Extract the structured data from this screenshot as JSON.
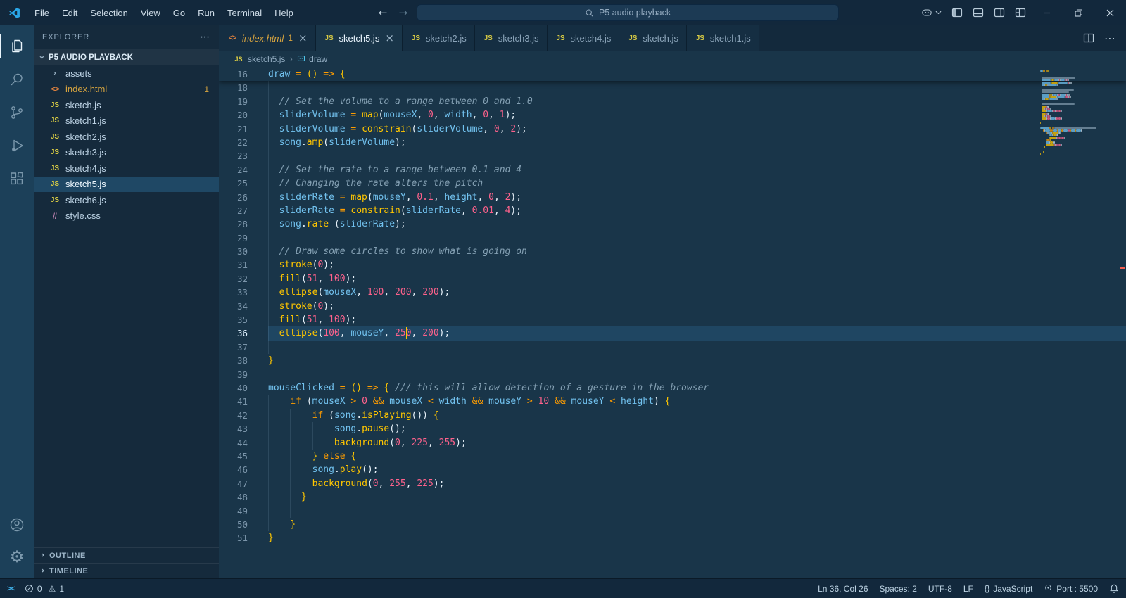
{
  "titlebar": {
    "menus": [
      "File",
      "Edit",
      "Selection",
      "View",
      "Go",
      "Run",
      "Terminal",
      "Help"
    ],
    "search": "P5 audio playback"
  },
  "activitybar": {
    "items": [
      {
        "name": "explorer",
        "active": true
      },
      {
        "name": "search"
      },
      {
        "name": "source-control"
      },
      {
        "name": "run-debug"
      },
      {
        "name": "extensions"
      }
    ],
    "bottom": [
      {
        "name": "account"
      },
      {
        "name": "settings"
      }
    ]
  },
  "sidebar": {
    "title": "EXPLORER",
    "project": "P5 AUDIO PLAYBACK",
    "files": [
      {
        "label": "assets",
        "icon": "folder"
      },
      {
        "label": "index.html",
        "icon": "html",
        "badge": "1",
        "warning": true
      },
      {
        "label": "sketch.js",
        "icon": "js"
      },
      {
        "label": "sketch1.js",
        "icon": "js"
      },
      {
        "label": "sketch2.js",
        "icon": "js"
      },
      {
        "label": "sketch3.js",
        "icon": "js"
      },
      {
        "label": "sketch4.js",
        "icon": "js"
      },
      {
        "label": "sketch5.js",
        "icon": "js",
        "selected": true
      },
      {
        "label": "sketch6.js",
        "icon": "js"
      },
      {
        "label": "style.css",
        "icon": "css"
      }
    ],
    "sections": [
      "OUTLINE",
      "TIMELINE"
    ]
  },
  "tabs": [
    {
      "label": "index.html",
      "icon": "html",
      "badge": "1",
      "warning": true,
      "closable": true
    },
    {
      "label": "sketch5.js",
      "icon": "js",
      "active": true,
      "closable": true
    },
    {
      "label": "sketch2.js",
      "icon": "js"
    },
    {
      "label": "sketch3.js",
      "icon": "js"
    },
    {
      "label": "sketch4.js",
      "icon": "js"
    },
    {
      "label": "sketch.js",
      "icon": "js"
    },
    {
      "label": "sketch1.js",
      "icon": "js"
    }
  ],
  "breadcrumb": [
    {
      "label": "sketch5.js",
      "icon": "js"
    },
    {
      "label": "draw",
      "icon": "symbol"
    }
  ],
  "editor": {
    "current_line": 36,
    "cursor_col": 26,
    "sticky": {
      "n": 16,
      "g": 0,
      "t": [
        [
          "v",
          "draw "
        ],
        [
          "k",
          "= "
        ],
        [
          "f",
          "()"
        ],
        [
          "p",
          " "
        ],
        [
          "k",
          "=> "
        ],
        [
          "f",
          "{"
        ]
      ]
    },
    "lines": [
      {
        "n": 18,
        "g": 2,
        "t": []
      },
      {
        "n": 19,
        "g": 2,
        "t": [
          [
            "c",
            "  // Set the volume to a range between 0 and 1.0"
          ]
        ]
      },
      {
        "n": 20,
        "g": 2,
        "t": [
          [
            "p",
            "  "
          ],
          [
            "v",
            "sliderVolume "
          ],
          [
            "k",
            "= "
          ],
          [
            "f",
            "map"
          ],
          [
            "p",
            "("
          ],
          [
            "v",
            "mouseX"
          ],
          [
            "p",
            ", "
          ],
          [
            "n",
            "0"
          ],
          [
            "p",
            ", "
          ],
          [
            "v",
            "width"
          ],
          [
            "p",
            ", "
          ],
          [
            "n",
            "0"
          ],
          [
            "p",
            ", "
          ],
          [
            "n",
            "1"
          ],
          [
            "p",
            ");"
          ]
        ]
      },
      {
        "n": 21,
        "g": 2,
        "t": [
          [
            "p",
            "  "
          ],
          [
            "v",
            "sliderVolume "
          ],
          [
            "k",
            "= "
          ],
          [
            "f",
            "constrain"
          ],
          [
            "p",
            "("
          ],
          [
            "v",
            "sliderVolume"
          ],
          [
            "p",
            ", "
          ],
          [
            "n",
            "0"
          ],
          [
            "p",
            ", "
          ],
          [
            "n",
            "2"
          ],
          [
            "p",
            ");"
          ]
        ]
      },
      {
        "n": 22,
        "g": 2,
        "t": [
          [
            "p",
            "  "
          ],
          [
            "v",
            "song"
          ],
          [
            "p",
            "."
          ],
          [
            "f",
            "amp"
          ],
          [
            "p",
            "("
          ],
          [
            "v",
            "sliderVolume"
          ],
          [
            "p",
            ");"
          ]
        ]
      },
      {
        "n": 23,
        "g": 2,
        "t": []
      },
      {
        "n": 24,
        "g": 2,
        "t": [
          [
            "c",
            "  // Set the rate to a range between 0.1 and 4"
          ]
        ]
      },
      {
        "n": 25,
        "g": 2,
        "t": [
          [
            "c",
            "  // Changing the rate alters the pitch"
          ]
        ]
      },
      {
        "n": 26,
        "g": 2,
        "t": [
          [
            "p",
            "  "
          ],
          [
            "v",
            "sliderRate "
          ],
          [
            "k",
            "= "
          ],
          [
            "f",
            "map"
          ],
          [
            "p",
            "("
          ],
          [
            "v",
            "mouseY"
          ],
          [
            "p",
            ", "
          ],
          [
            "n",
            "0.1"
          ],
          [
            "p",
            ", "
          ],
          [
            "v",
            "height"
          ],
          [
            "p",
            ", "
          ],
          [
            "n",
            "0"
          ],
          [
            "p",
            ", "
          ],
          [
            "n",
            "2"
          ],
          [
            "p",
            ");"
          ]
        ]
      },
      {
        "n": 27,
        "g": 2,
        "t": [
          [
            "p",
            "  "
          ],
          [
            "v",
            "sliderRate "
          ],
          [
            "k",
            "= "
          ],
          [
            "f",
            "constrain"
          ],
          [
            "p",
            "("
          ],
          [
            "v",
            "sliderRate"
          ],
          [
            "p",
            ", "
          ],
          [
            "n",
            "0.01"
          ],
          [
            "p",
            ", "
          ],
          [
            "n",
            "4"
          ],
          [
            "p",
            ");"
          ]
        ]
      },
      {
        "n": 28,
        "g": 2,
        "t": [
          [
            "p",
            "  "
          ],
          [
            "v",
            "song"
          ],
          [
            "p",
            "."
          ],
          [
            "f",
            "rate "
          ],
          [
            "p",
            "("
          ],
          [
            "v",
            "sliderRate"
          ],
          [
            "p",
            ");"
          ]
        ]
      },
      {
        "n": 29,
        "g": 2,
        "t": []
      },
      {
        "n": 30,
        "g": 2,
        "t": [
          [
            "c",
            "  // Draw some circles to show what is going on"
          ]
        ]
      },
      {
        "n": 31,
        "g": 2,
        "t": [
          [
            "p",
            "  "
          ],
          [
            "f",
            "stroke"
          ],
          [
            "p",
            "("
          ],
          [
            "n",
            "0"
          ],
          [
            "p",
            ");"
          ]
        ]
      },
      {
        "n": 32,
        "g": 2,
        "t": [
          [
            "p",
            "  "
          ],
          [
            "f",
            "fill"
          ],
          [
            "p",
            "("
          ],
          [
            "n",
            "51"
          ],
          [
            "p",
            ", "
          ],
          [
            "n",
            "100"
          ],
          [
            "p",
            ");"
          ]
        ]
      },
      {
        "n": 33,
        "g": 2,
        "t": [
          [
            "p",
            "  "
          ],
          [
            "f",
            "ellipse"
          ],
          [
            "p",
            "("
          ],
          [
            "v",
            "mouseX"
          ],
          [
            "p",
            ", "
          ],
          [
            "n",
            "100"
          ],
          [
            "p",
            ", "
          ],
          [
            "n",
            "200"
          ],
          [
            "p",
            ", "
          ],
          [
            "n",
            "200"
          ],
          [
            "p",
            ");"
          ]
        ]
      },
      {
        "n": 34,
        "g": 2,
        "t": [
          [
            "p",
            "  "
          ],
          [
            "f",
            "stroke"
          ],
          [
            "p",
            "("
          ],
          [
            "n",
            "0"
          ],
          [
            "p",
            ");"
          ]
        ]
      },
      {
        "n": 35,
        "g": 2,
        "t": [
          [
            "p",
            "  "
          ],
          [
            "f",
            "fill"
          ],
          [
            "p",
            "("
          ],
          [
            "n",
            "51"
          ],
          [
            "p",
            ", "
          ],
          [
            "n",
            "100"
          ],
          [
            "p",
            ");"
          ]
        ]
      },
      {
        "n": 36,
        "g": 2,
        "t": [
          [
            "p",
            "  "
          ],
          [
            "f",
            "ellipse"
          ],
          [
            "p",
            "("
          ],
          [
            "n",
            "100"
          ],
          [
            "p",
            ", "
          ],
          [
            "v",
            "mouseY"
          ],
          [
            "p",
            ", "
          ],
          [
            "n",
            "250"
          ],
          [
            "p",
            ", "
          ],
          [
            "n",
            "200"
          ],
          [
            "p",
            ");"
          ]
        ]
      },
      {
        "n": 37,
        "g": 2,
        "t": []
      },
      {
        "n": 38,
        "g": 0,
        "t": [
          [
            "f",
            "}"
          ]
        ]
      },
      {
        "n": 39,
        "g": 0,
        "t": []
      },
      {
        "n": 40,
        "g": 0,
        "t": [
          [
            "v",
            "mouseClicked "
          ],
          [
            "k",
            "= "
          ],
          [
            "f",
            "()"
          ],
          [
            "p",
            " "
          ],
          [
            "k",
            "=> "
          ],
          [
            "f",
            "{ "
          ],
          [
            "c",
            "/// this will allow detection of a gesture in the browser"
          ]
        ]
      },
      {
        "n": 41,
        "g": 4,
        "t": [
          [
            "p",
            "    "
          ],
          [
            "k",
            "if "
          ],
          [
            "p",
            "("
          ],
          [
            "v",
            "mouseX "
          ],
          [
            "k",
            "> "
          ],
          [
            "n",
            "0 "
          ],
          [
            "k",
            "&& "
          ],
          [
            "v",
            "mouseX "
          ],
          [
            "k",
            "< "
          ],
          [
            "v",
            "width "
          ],
          [
            "k",
            "&& "
          ],
          [
            "v",
            "mouseY "
          ],
          [
            "k",
            "> "
          ],
          [
            "n",
            "10 "
          ],
          [
            "k",
            "&& "
          ],
          [
            "v",
            "mouseY "
          ],
          [
            "k",
            "< "
          ],
          [
            "v",
            "height"
          ],
          [
            "p",
            ") "
          ],
          [
            "f",
            "{"
          ]
        ]
      },
      {
        "n": 42,
        "g": 8,
        "t": [
          [
            "p",
            "        "
          ],
          [
            "k",
            "if "
          ],
          [
            "p",
            "("
          ],
          [
            "v",
            "song"
          ],
          [
            "p",
            "."
          ],
          [
            "f",
            "isPlaying"
          ],
          [
            "p",
            "()) "
          ],
          [
            "f",
            "{"
          ]
        ]
      },
      {
        "n": 43,
        "g": 12,
        "t": [
          [
            "p",
            "            "
          ],
          [
            "v",
            "song"
          ],
          [
            "p",
            "."
          ],
          [
            "f",
            "pause"
          ],
          [
            "p",
            "();"
          ]
        ]
      },
      {
        "n": 44,
        "g": 12,
        "t": [
          [
            "p",
            "            "
          ],
          [
            "f",
            "background"
          ],
          [
            "p",
            "("
          ],
          [
            "n",
            "0"
          ],
          [
            "p",
            ", "
          ],
          [
            "n",
            "225"
          ],
          [
            "p",
            ", "
          ],
          [
            "n",
            "255"
          ],
          [
            "p",
            ");"
          ]
        ]
      },
      {
        "n": 45,
        "g": 8,
        "t": [
          [
            "p",
            "        "
          ],
          [
            "f",
            "} "
          ],
          [
            "k",
            "else "
          ],
          [
            "f",
            "{"
          ]
        ]
      },
      {
        "n": 46,
        "g": 8,
        "t": [
          [
            "p",
            "        "
          ],
          [
            "v",
            "song"
          ],
          [
            "p",
            "."
          ],
          [
            "f",
            "play"
          ],
          [
            "p",
            "();"
          ]
        ]
      },
      {
        "n": 47,
        "g": 8,
        "t": [
          [
            "p",
            "        "
          ],
          [
            "f",
            "background"
          ],
          [
            "p",
            "("
          ],
          [
            "n",
            "0"
          ],
          [
            "p",
            ", "
          ],
          [
            "n",
            "255"
          ],
          [
            "p",
            ", "
          ],
          [
            "n",
            "225"
          ],
          [
            "p",
            ");"
          ]
        ]
      },
      {
        "n": 48,
        "g": 6,
        "t": [
          [
            "p",
            "      "
          ],
          [
            "f",
            "}"
          ]
        ]
      },
      {
        "n": 49,
        "g": 8,
        "t": []
      },
      {
        "n": 50,
        "g": 4,
        "t": [
          [
            "p",
            "    "
          ],
          [
            "f",
            "}"
          ]
        ]
      },
      {
        "n": 51,
        "g": 0,
        "t": [
          [
            "f",
            "}"
          ]
        ]
      }
    ]
  },
  "statusbar": {
    "errors": "0",
    "warnings": "1",
    "items": [
      {
        "label": "Ln 36, Col 26"
      },
      {
        "label": "Spaces: 2"
      },
      {
        "label": "UTF-8"
      },
      {
        "label": "LF"
      },
      {
        "label": "JavaScript",
        "icon": "braces"
      },
      {
        "label": "Port : 5500",
        "icon": "broadcast"
      }
    ]
  },
  "colors": {
    "accent": "#ffc600",
    "editor_bg": "#193549",
    "warning": "#d7a43f",
    "overview_mark": "#f25d4e"
  }
}
